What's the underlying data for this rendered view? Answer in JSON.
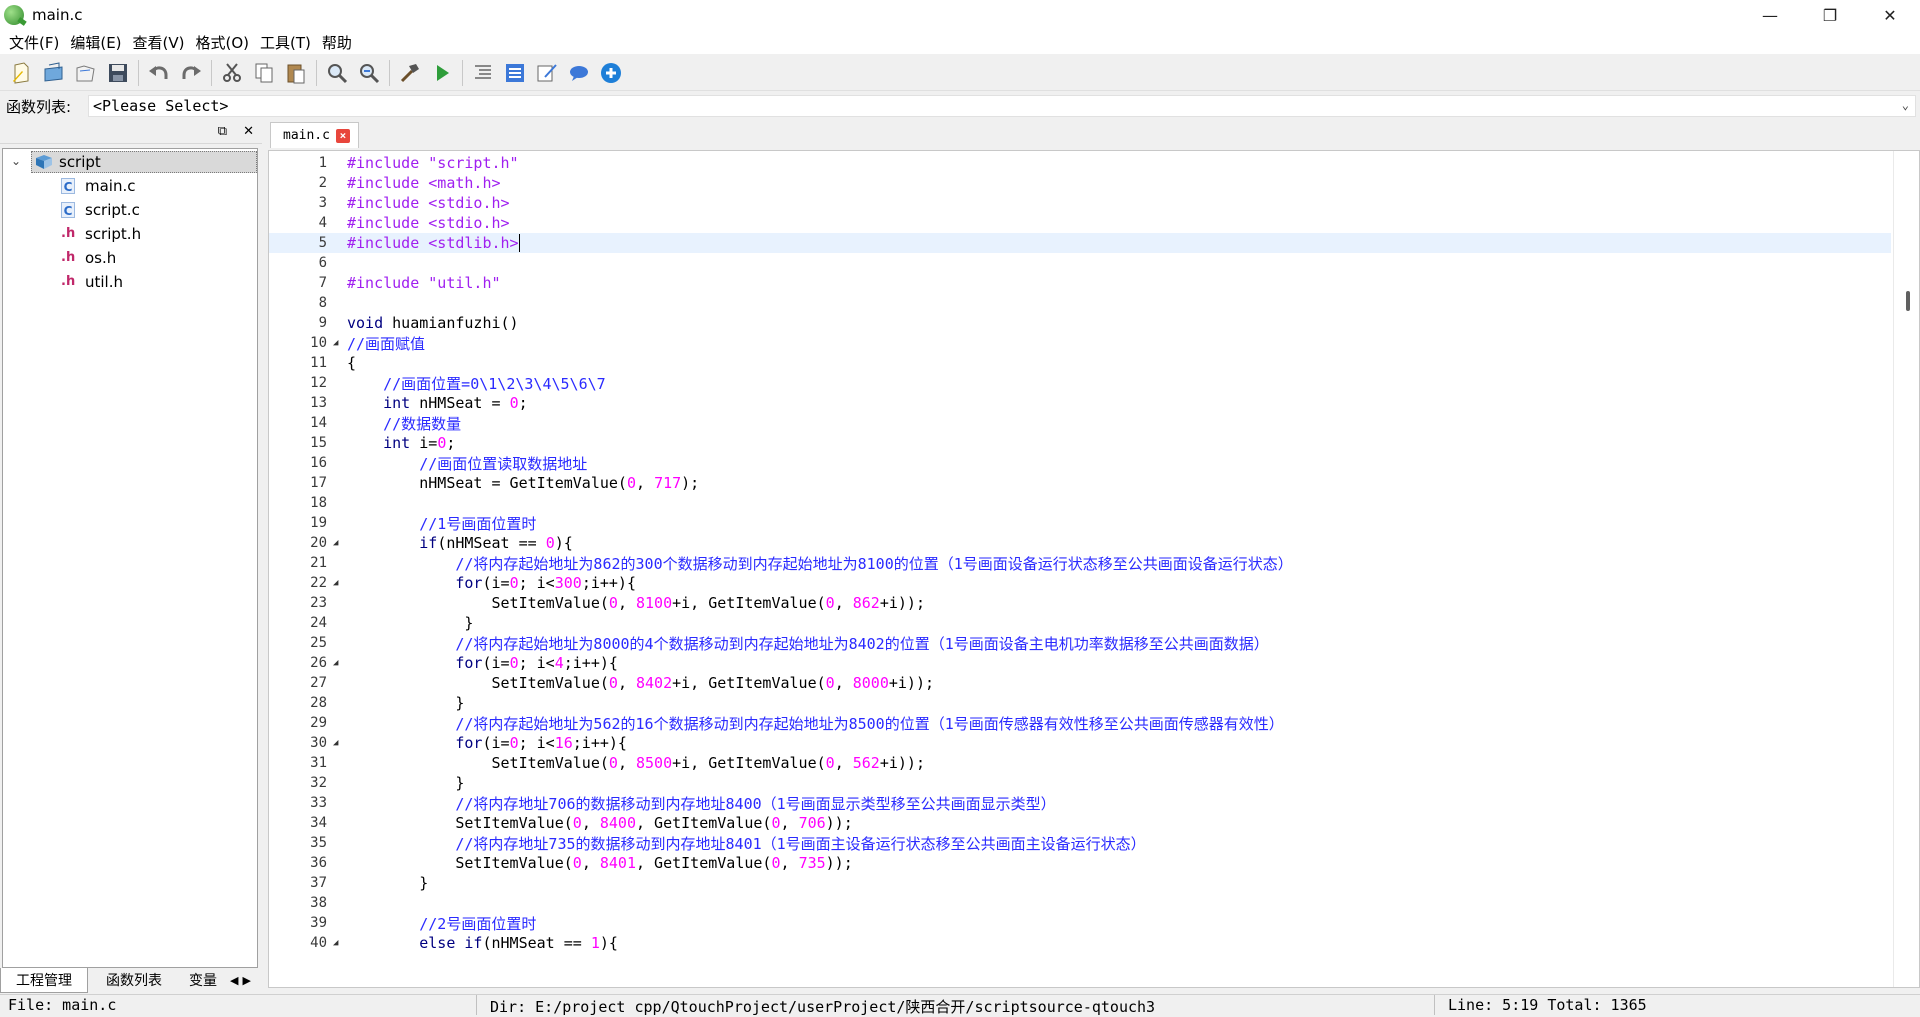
{
  "window": {
    "title": "main.c",
    "minimize": "—",
    "restore": "❐",
    "close": "✕"
  },
  "menu": [
    "文件(F)",
    "编辑(E)",
    "查看(V)",
    "格式(O)",
    "工具(T)",
    "帮助"
  ],
  "toolbar": {
    "icons": [
      "new-file-icon",
      "open-icon",
      "open-folder-icon",
      "save-icon",
      "undo-icon",
      "redo-icon",
      "cut-icon",
      "copy-icon",
      "paste-icon",
      "find-icon",
      "find-replace-icon",
      "build-icon",
      "run-icon",
      "outdent-icon",
      "list-icon",
      "edit-note-icon",
      "comment-icon",
      "add-icon"
    ]
  },
  "function_list": {
    "label": "函数列表:",
    "value": "<Please Select>"
  },
  "left_panel": {
    "tree": {
      "root": "script",
      "files": [
        {
          "name": "main.c",
          "type": "c"
        },
        {
          "name": "script.c",
          "type": "c"
        },
        {
          "name": "script.h",
          "type": "h"
        },
        {
          "name": "os.h",
          "type": "h"
        },
        {
          "name": "util.h",
          "type": "h"
        }
      ]
    },
    "tabs": [
      "工程管理",
      "函数列表",
      "变量"
    ]
  },
  "editor": {
    "tab": "main.c",
    "lines": [
      {
        "n": "1",
        "segs": [
          [
            "pp",
            "#include \"script.h\""
          ]
        ]
      },
      {
        "n": "2",
        "segs": [
          [
            "pp",
            "#include <math.h>"
          ]
        ]
      },
      {
        "n": "3",
        "segs": [
          [
            "pp",
            "#include <stdio.h>"
          ]
        ]
      },
      {
        "n": "4",
        "segs": [
          [
            "pp",
            "#include <stdio.h>"
          ]
        ]
      },
      {
        "n": "5",
        "segs": [
          [
            "pp",
            "#include <stdlib.h>"
          ]
        ],
        "current": true
      },
      {
        "n": "6",
        "segs": []
      },
      {
        "n": "7",
        "segs": [
          [
            "pp",
            "#include \"util.h\""
          ]
        ]
      },
      {
        "n": "8",
        "segs": []
      },
      {
        "n": "9",
        "segs": [
          [
            "kw",
            "void"
          ],
          [
            "op",
            " huamianfuzhi()"
          ]
        ]
      },
      {
        "n": "10",
        "fold": true,
        "segs": [
          [
            "cm",
            "//画面赋值"
          ]
        ]
      },
      {
        "n": "11",
        "segs": [
          [
            "op",
            "{"
          ]
        ]
      },
      {
        "n": "12",
        "segs": [
          [
            "op",
            "    "
          ],
          [
            "cm",
            "//画面位置=0\\1\\2\\3\\4\\5\\6\\7"
          ]
        ]
      },
      {
        "n": "13",
        "segs": [
          [
            "op",
            "    "
          ],
          [
            "kw",
            "int"
          ],
          [
            "op",
            " nHMSeat = "
          ],
          [
            "num",
            "0"
          ],
          [
            "op",
            ";"
          ]
        ]
      },
      {
        "n": "14",
        "segs": [
          [
            "op",
            "    "
          ],
          [
            "cm",
            "//数据数量"
          ]
        ]
      },
      {
        "n": "15",
        "segs": [
          [
            "op",
            "    "
          ],
          [
            "kw",
            "int"
          ],
          [
            "op",
            " i="
          ],
          [
            "num",
            "0"
          ],
          [
            "op",
            ";"
          ]
        ]
      },
      {
        "n": "16",
        "segs": [
          [
            "op",
            "        "
          ],
          [
            "cm",
            "//画面位置读取数据地址"
          ]
        ]
      },
      {
        "n": "17",
        "segs": [
          [
            "op",
            "        nHMSeat = GetItemValue("
          ],
          [
            "num",
            "0"
          ],
          [
            "op",
            ", "
          ],
          [
            "num",
            "717"
          ],
          [
            "op",
            ");"
          ]
        ]
      },
      {
        "n": "18",
        "segs": []
      },
      {
        "n": "19",
        "segs": [
          [
            "op",
            "        "
          ],
          [
            "cm",
            "//1号画面位置时"
          ]
        ]
      },
      {
        "n": "20",
        "fold": true,
        "segs": [
          [
            "op",
            "        "
          ],
          [
            "kw",
            "if"
          ],
          [
            "op",
            "(nHMSeat == "
          ],
          [
            "num",
            "0"
          ],
          [
            "op",
            "){"
          ]
        ]
      },
      {
        "n": "21",
        "segs": [
          [
            "op",
            "            "
          ],
          [
            "cm",
            "//将内存起始地址为862的300个数据移动到内存起始地址为8100的位置（1号画面设备运行状态移至公共画面设备运行状态）"
          ]
        ]
      },
      {
        "n": "22",
        "fold": true,
        "segs": [
          [
            "op",
            "            "
          ],
          [
            "kw",
            "for"
          ],
          [
            "op",
            "(i="
          ],
          [
            "num",
            "0"
          ],
          [
            "op",
            "; i<"
          ],
          [
            "num",
            "300"
          ],
          [
            "op",
            ";i++){"
          ]
        ]
      },
      {
        "n": "23",
        "segs": [
          [
            "op",
            "                SetItemValue("
          ],
          [
            "num",
            "0"
          ],
          [
            "op",
            ", "
          ],
          [
            "num",
            "8100"
          ],
          [
            "op",
            "+i, GetItemValue("
          ],
          [
            "num",
            "0"
          ],
          [
            "op",
            ", "
          ],
          [
            "num",
            "862"
          ],
          [
            "op",
            "+i));"
          ]
        ]
      },
      {
        "n": "24",
        "segs": [
          [
            "op",
            "             }"
          ]
        ]
      },
      {
        "n": "25",
        "segs": [
          [
            "op",
            "            "
          ],
          [
            "cm",
            "//将内存起始地址为8000的4个数据移动到内存起始地址为8402的位置（1号画面设备主电机功率数据移至公共画面数据）"
          ]
        ]
      },
      {
        "n": "26",
        "fold": true,
        "segs": [
          [
            "op",
            "            "
          ],
          [
            "kw",
            "for"
          ],
          [
            "op",
            "(i="
          ],
          [
            "num",
            "0"
          ],
          [
            "op",
            "; i<"
          ],
          [
            "num",
            "4"
          ],
          [
            "op",
            ";i++){"
          ]
        ]
      },
      {
        "n": "27",
        "segs": [
          [
            "op",
            "                SetItemValue("
          ],
          [
            "num",
            "0"
          ],
          [
            "op",
            ", "
          ],
          [
            "num",
            "8402"
          ],
          [
            "op",
            "+i, GetItemValue("
          ],
          [
            "num",
            "0"
          ],
          [
            "op",
            ", "
          ],
          [
            "num",
            "8000"
          ],
          [
            "op",
            "+i));"
          ]
        ]
      },
      {
        "n": "28",
        "segs": [
          [
            "op",
            "            }"
          ]
        ]
      },
      {
        "n": "29",
        "segs": [
          [
            "op",
            "            "
          ],
          [
            "cm",
            "//将内存起始地址为562的16个数据移动到内存起始地址为8500的位置（1号画面传感器有效性移至公共画面传感器有效性）"
          ]
        ]
      },
      {
        "n": "30",
        "fold": true,
        "segs": [
          [
            "op",
            "            "
          ],
          [
            "kw",
            "for"
          ],
          [
            "op",
            "(i="
          ],
          [
            "num",
            "0"
          ],
          [
            "op",
            "; i<"
          ],
          [
            "num",
            "16"
          ],
          [
            "op",
            ";i++){"
          ]
        ]
      },
      {
        "n": "31",
        "segs": [
          [
            "op",
            "                SetItemValue("
          ],
          [
            "num",
            "0"
          ],
          [
            "op",
            ", "
          ],
          [
            "num",
            "8500"
          ],
          [
            "op",
            "+i, GetItemValue("
          ],
          [
            "num",
            "0"
          ],
          [
            "op",
            ", "
          ],
          [
            "num",
            "562"
          ],
          [
            "op",
            "+i));"
          ]
        ]
      },
      {
        "n": "32",
        "segs": [
          [
            "op",
            "            }"
          ]
        ]
      },
      {
        "n": "33",
        "segs": [
          [
            "op",
            "            "
          ],
          [
            "cm",
            "//将内存地址706的数据移动到内存地址8400（1号画面显示类型移至公共画面显示类型）"
          ]
        ]
      },
      {
        "n": "34",
        "segs": [
          [
            "op",
            "            SetItemValue("
          ],
          [
            "num",
            "0"
          ],
          [
            "op",
            ", "
          ],
          [
            "num",
            "8400"
          ],
          [
            "op",
            ", GetItemValue("
          ],
          [
            "num",
            "0"
          ],
          [
            "op",
            ", "
          ],
          [
            "num",
            "706"
          ],
          [
            "op",
            "));"
          ]
        ]
      },
      {
        "n": "35",
        "segs": [
          [
            "op",
            "            "
          ],
          [
            "cm",
            "//将内存地址735的数据移动到内存地址8401（1号画面主设备运行状态移至公共画面主设备运行状态）"
          ]
        ]
      },
      {
        "n": "36",
        "segs": [
          [
            "op",
            "            SetItemValue("
          ],
          [
            "num",
            "0"
          ],
          [
            "op",
            ", "
          ],
          [
            "num",
            "8401"
          ],
          [
            "op",
            ", GetItemValue("
          ],
          [
            "num",
            "0"
          ],
          [
            "op",
            ", "
          ],
          [
            "num",
            "735"
          ],
          [
            "op",
            "));"
          ]
        ]
      },
      {
        "n": "37",
        "segs": [
          [
            "op",
            "        }"
          ]
        ]
      },
      {
        "n": "38",
        "segs": []
      },
      {
        "n": "39",
        "segs": [
          [
            "op",
            "        "
          ],
          [
            "cm",
            "//2号画面位置时"
          ]
        ]
      },
      {
        "n": "40",
        "fold": true,
        "segs": [
          [
            "op",
            "        "
          ],
          [
            "kw",
            "else if"
          ],
          [
            "op",
            "(nHMSeat == "
          ],
          [
            "num",
            "1"
          ],
          [
            "op",
            "){"
          ]
        ]
      }
    ]
  },
  "status": {
    "file": "File: main.c",
    "dir": "Dir: E:/project cpp/QtouchProject/userProject/陕西合开/scriptsource-qtouch3",
    "line": "Line: 5:19 Total: 1365"
  },
  "colors": {
    "preprocessor": "#a020f0",
    "comment": "#2a2aff",
    "number": "#ff00ff",
    "keyword": "#000080",
    "current_line": "#e8f2fe"
  }
}
